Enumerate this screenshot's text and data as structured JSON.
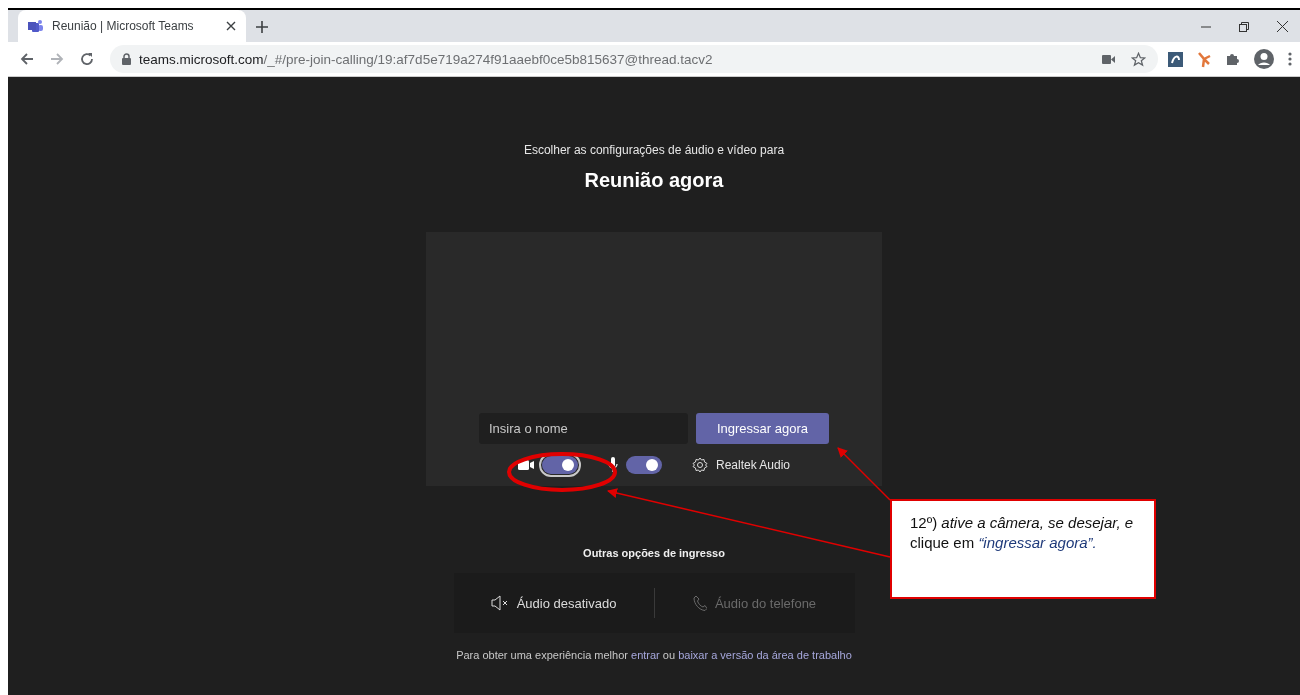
{
  "browser": {
    "tab": {
      "title": "Reunião | Microsoft Teams",
      "selected": true
    },
    "address": {
      "host": "teams.microsoft.com",
      "path": "/_#/pre-join-calling/19:af7d5e719a274f91aaebf0ce5b815637@thread.tacv2"
    }
  },
  "prejoin": {
    "subtitle": "Escolher as configurações de áudio e vídeo para",
    "title": "Reunião agora",
    "name_field": {
      "placeholder": "Insira o nome"
    },
    "join_button": "Ingressar agora",
    "camera": {
      "on": true
    },
    "microphone": {
      "on": true
    },
    "audio_device": "Realtek Audio"
  },
  "other_options": {
    "heading": "Outras opções de ingresso",
    "options": [
      {
        "kind": "audio-off",
        "label": "Áudio desativado",
        "disabled": false
      },
      {
        "kind": "phone",
        "label": "Áudio do telefone",
        "disabled": true
      }
    ]
  },
  "footer": {
    "text": "Para obter uma experiência melhor",
    "link_1": "entrar",
    "middle": "ou",
    "link_2": "baixar a versão da área de trabalho"
  },
  "callout": {
    "text": "12º) *ative a câmera, se desejar, e* clique em",
    "highlight": "“ingressar agora”."
  }
}
